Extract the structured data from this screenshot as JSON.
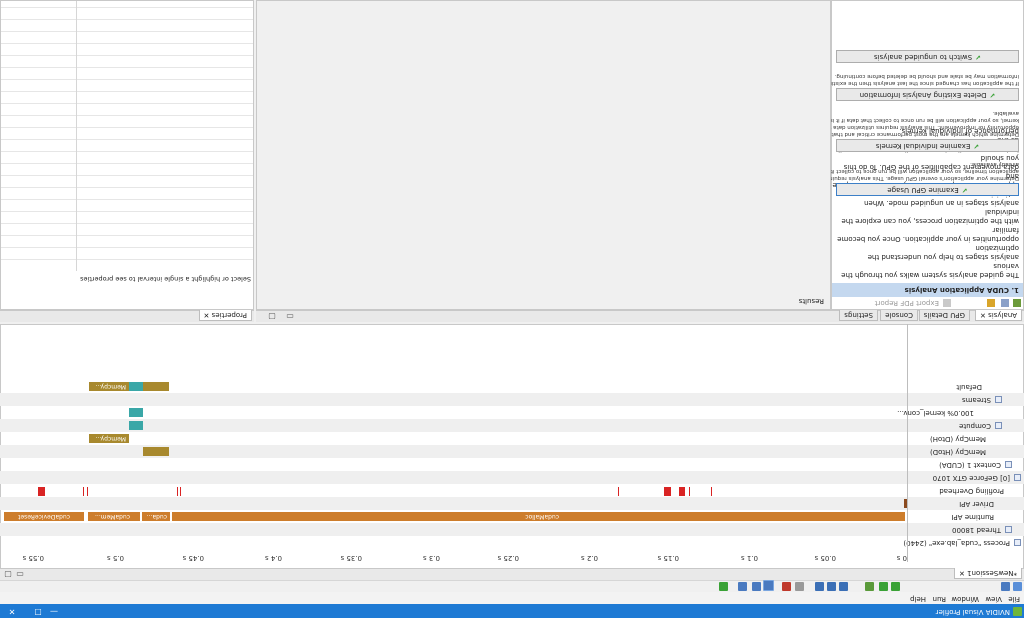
{
  "app": {
    "title": "NVIDIA Visual Profiler"
  },
  "menu": [
    "File",
    "View",
    "Window",
    "Run",
    "Help"
  ],
  "timeline": {
    "tab_label": "*NewSession1",
    "ruler": [
      "0 s",
      "0.05 s",
      "0.1 s",
      "0.15 s",
      "0.2 s",
      "0.25 s",
      "0.3 s",
      "0.35 s",
      "0.4 s",
      "0.45 s",
      "0.5 s",
      "0.55 s"
    ],
    "tree": [
      "Process \"cuda_lab.exe\" (2440)",
      "Thread 18000",
      "Runtime API",
      "Driver API",
      "Profiling Overhead",
      "[0] GeForce GTX 1070",
      "Context 1 (CUDA)",
      "MemCpy (HtoD)",
      "MemCpy (DtoH)",
      "Compute",
      "100.0% kernel_conv...",
      "Streams",
      "Default"
    ],
    "bar_labels": {
      "malloc": "cudaMalloc",
      "cuda_short": "cuda...",
      "memcpy": "cudaMem...",
      "reset": "cudaDeviceReset",
      "memcpy_dtoh": "Memcpy...",
      "memcpy_default": "Memcpy..."
    }
  },
  "analysis": {
    "tabs": [
      "Analysis",
      "GPU Details",
      "Console",
      "Settings"
    ],
    "export": "Export PDF Report",
    "section": "1. CUDA Application Analysis",
    "intro": [
      "The guided analysis system walks you through the various",
      "analysis stages to help you understand the optimization",
      "opportunities in your application. Once you become familiar",
      "with the optimization process, you can explore the individual",
      "analysis stages in an unguided mode. When optimizing your",
      "application it is important to fully utilize the compute and",
      "data movement capabilities of the GPU. To do this you should",
      "look at your application's overall GPU usage as well as the",
      "performance of individual kernels."
    ],
    "buttons": [
      "Examine GPU Usage",
      "Examine Individual Kernels",
      "Delete Existing Analysis Information",
      "Switch to unguided analysis"
    ],
    "desc1": [
      "Determine your application's overall GPU usage. This analysis requires an",
      "application timeline, so your application will be run once to collect it if it is not",
      "already available."
    ],
    "desc2": [
      "Determine which kernels are the most performance critical and that have the most",
      "opportunity for improvement. This analysis requires utilization data from every",
      "kernel, so your application will be run once to collect that data if it is not already",
      "available."
    ],
    "desc3": [
      "If the application has changed since the last analysis then the existing analysis",
      "information may be stale and should be deleted before continuing."
    ]
  },
  "results": {
    "label": "Results"
  },
  "properties": {
    "tab": "Properties",
    "hint": "Select or highlight a single interval to see properties"
  },
  "colors": {
    "accent": "#1e7ad4",
    "runtime": "#cd7d2c",
    "memcpy": "#a8892e",
    "kernel": "#3aa7a7",
    "overhead": "#d92424"
  }
}
